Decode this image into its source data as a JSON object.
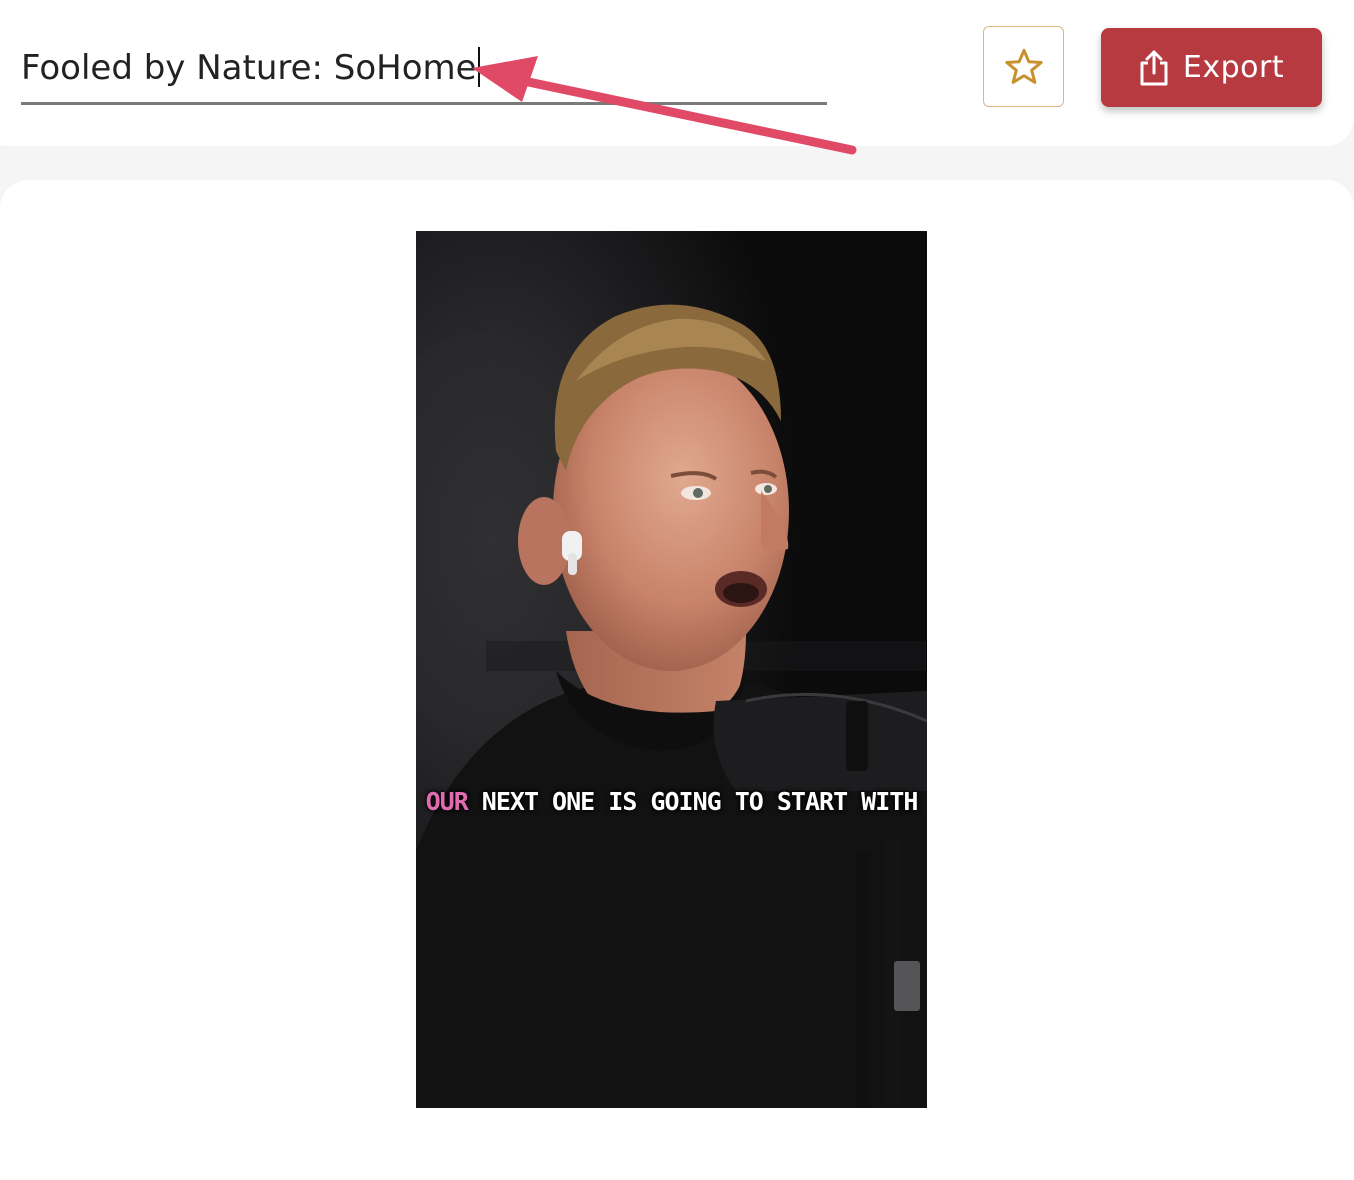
{
  "header": {
    "title_value": "Fooled by Nature: SoHome",
    "favorite_icon": "star-outline-icon",
    "export": {
      "icon": "share-upload-icon",
      "label": "Export"
    }
  },
  "video": {
    "caption_highlight": "OUR",
    "caption_rest": " NEXT ONE IS GOING TO START WITH"
  },
  "colors": {
    "accent": "#b83a41",
    "star": "#c9902e",
    "annotation_arrow": "#e04a66",
    "caption_highlight": "#e06bb0"
  }
}
